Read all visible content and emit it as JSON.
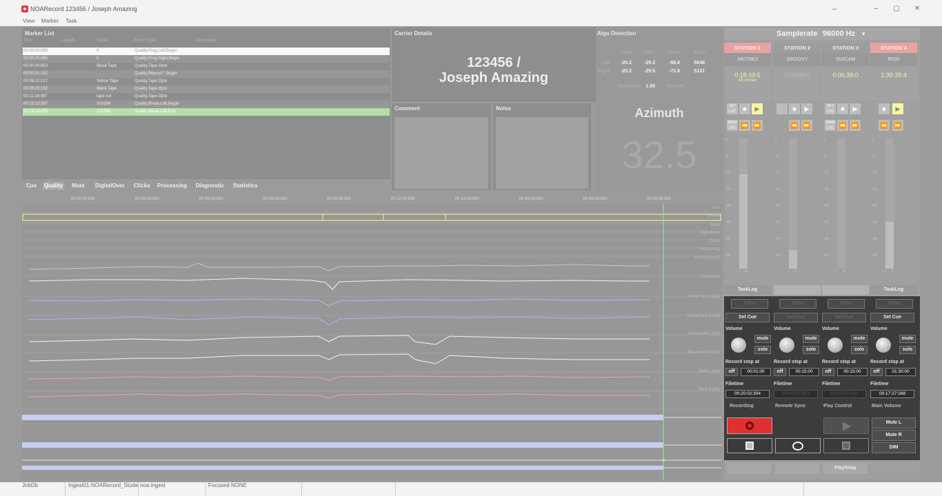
{
  "window": {
    "title": "NOARecord 123456 / Joseph Amazing",
    "min": "–",
    "max": "▢",
    "close": "✕",
    "resize": "↔"
  },
  "menu": [
    "View",
    "Marker",
    "Task"
  ],
  "marker_list": {
    "title": "Marker List",
    "columns": [
      "Time",
      "Length",
      "Value",
      "Event Type",
      "Description"
    ],
    "rows": [
      {
        "time": "00:00:00:085",
        "value": "0",
        "event": "Quality.Prog.Left.Begin"
      },
      {
        "time": "00:00:00:085",
        "value": "0",
        "event": "Quality.Prog.Right.Begin"
      },
      {
        "time": "00:00:00:853",
        "value": "Black Tape",
        "event": "Quality.Tape.Opto"
      },
      {
        "time": "00:00:01:152",
        "value": "",
        "event": "Quality.Bitproof.*.Begin"
      },
      {
        "time": "00:06:22:227",
        "value": "Yellow Tape",
        "event": "Quality.Tape.Opto"
      },
      {
        "time": "00:09:25:152",
        "value": "Black Tape",
        "event": "Quality.Tape.Opto"
      },
      {
        "time": "00:11:16:087",
        "value": "tape cut",
        "event": "Quality.Tape.Opto"
      },
      {
        "time": "00:13:13:397",
        "value": "101564",
        "event": "Quality.Break.Left.Begin"
      },
      {
        "time": "00:13:14:455",
        "value": "101564",
        "event": "Quality.Break.Left.End"
      }
    ]
  },
  "carrier": {
    "title": "Carrier Details",
    "line1": "123456 /",
    "line2": "Joseph Amazing"
  },
  "algo": {
    "title": "Algo Detection",
    "headers": [
      "Peak",
      "RMS",
      "Noise",
      "Band"
    ],
    "left": {
      "label": "Left",
      "values": [
        "-20.2",
        "-29.3",
        "-68.9",
        "5648"
      ]
    },
    "right": {
      "label": "Right",
      "values": [
        "-20.2",
        "-29.5",
        "-72.9",
        "5121"
      ]
    },
    "correlation_label": "Correlation",
    "correlation": "1.00",
    "azimuth_label": "Azimuth"
  },
  "comment": {
    "title": "Comment"
  },
  "notes": {
    "title": "Notes"
  },
  "azimuth": {
    "title": "Azimuth",
    "value": "32.5"
  },
  "tabs": [
    "Cue",
    "Quality",
    "Mute",
    "DigitalOver",
    "Clicks",
    "Processing",
    "Diagnostic",
    "Statistics"
  ],
  "active_tab": "Quality",
  "ruler": [
    "00:02:00:000",
    "00:04:00:000",
    "00:06:00:000",
    "00:08:00:000",
    "00:10:00:000",
    "00:12:00:000",
    "00:14:00:000",
    "00:16:00:000",
    "00:18:00:000",
    "00:20:00:000"
  ],
  "lanes": [
    "Cue",
    "Quality",
    "Mute",
    "DigitalOver",
    "Clicks",
    "Processing",
    "Azimuth (x10)",
    "Correlation",
    "NoiseFloor L [dB]",
    "NoiseFloor R [dB]",
    "Bandwidth L [Hz]",
    "Bandwidth R [Hz]",
    "RMS L [dB]",
    "RMS R [dB]"
  ],
  "samplerate": {
    "label": "Samplerate",
    "value": "96000 Hz",
    "caret": "▾"
  },
  "stations": [
    {
      "name": "STATION 1",
      "model": "A807MK2",
      "time": "0:18:49:5",
      "speed": "19 cm/sec",
      "active": true
    },
    {
      "name": "STATION 2",
      "model": "GROOVY",
      "time": "0:00:00:0",
      "speed": "",
      "active": false
    },
    {
      "name": "STATION 3",
      "model": "TASCAM",
      "time": "0:06:39:0",
      "speed": "",
      "active": false
    },
    {
      "name": "STATION 4",
      "model": "R500",
      "time": "1:39:39:4",
      "speed": "",
      "active": true
    }
  ],
  "transport": {
    "set_loc": "SET LOC",
    "wind_loc": "WIND LOC",
    "stop": "■",
    "play": "▶",
    "rew": "⏪",
    "ff": "⏩"
  },
  "meter_ticks": [
    "0",
    "-5",
    "-10",
    "-15",
    "-20",
    "-30",
    "-40",
    "-60"
  ],
  "meter_lr": [
    "L",
    "R"
  ],
  "meter_levels": [
    0.72,
    0.14,
    0.0,
    0.36
  ],
  "tasklog": {
    "label": "TaskLog"
  },
  "filter_label": "Filter",
  "set_cue": "Set Cue",
  "volume_label": "Volume",
  "mute": "mute",
  "solo": "solo",
  "record_stop_label": "Record stop at",
  "off": "off",
  "record_stop_times": [
    "00:01:00",
    "00:15:00",
    "00:15:00",
    "01:30:00"
  ],
  "filetime_label": "Filetime",
  "filetimes": [
    "00:20:02:304",
    "00:00:00:000",
    "00:00:00:000",
    "00:17:27:168"
  ],
  "bottom": {
    "recording": "Recording",
    "remote_sync": "Remote Sync",
    "play_control": "Play Control",
    "main_volume": "Main Volume",
    "mute_l": "Mute L",
    "mute_r": "Mute R",
    "dim": "DIM",
    "playsnap": "PlaySnap"
  },
  "status": [
    "JobDb",
    "Ingest01.NOARecord_Stude",
    "noa.ingest",
    "Focused NONE"
  ],
  "colors": {
    "station_active": "#e9a2a2",
    "time_yellow": "#f7f2a6",
    "highlight_row": "#b6dfa8",
    "playhead": "#9ae89a",
    "record_red": "#e03030"
  }
}
